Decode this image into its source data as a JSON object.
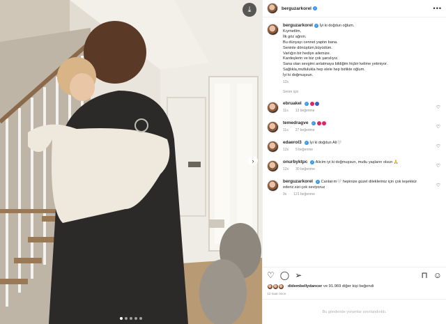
{
  "post": {
    "username": "berguzarkorel",
    "more_label": "•••",
    "caption_lines": [
      "İyi ki doğdun oğlum.",
      "Kıymetlim,",
      "İlk göz ağrım.",
      "Bu dünyayı cennet yaptın bana.",
      "Seninle dönüştüm,büyüdüm.",
      "Varlığın bir hediye ailemize.",
      "Kardeşlerin ve biz çok şanslıyız.",
      "Sana olan sevgimi anlatmaya bildiğim hiçbir kelime yetmiyor.",
      "Sağlıkla,mutlulukla hep elele hep birlikte oğlum.",
      "İyi ki doğmuşsun."
    ],
    "caption_time": "12s",
    "translate_label": "Seren için",
    "likes_users": "didembellydancer",
    "likes_text": "ve 91.969 diğer kişi beğendi",
    "post_time": "12 saat önce",
    "add_comment_placeholder": "Bu gönderide yorumlar sınırlandırıldı."
  },
  "comments": [
    {
      "username": "ebruakel",
      "text": "",
      "time": "11s",
      "likes": "13 beğenme",
      "emoji_colors": [
        "#e0245e",
        "#3a5cc9"
      ]
    },
    {
      "username": "temedragve",
      "text": "",
      "time": "11s",
      "likes": "27 beğenme",
      "emoji_colors": [
        "#e0245e",
        "#e0245e"
      ]
    },
    {
      "username": "edaerol3",
      "text": "İyi ki doğdun Ali🤍",
      "time": "12s",
      "likes": "5 beğenme",
      "emoji_colors": []
    },
    {
      "username": "onurbyktpc",
      "text": "Alicim iyi ki doğmuşsun, mutlu yaşların olsun 🙏",
      "time": "12s",
      "likes": "30 beğenme",
      "emoji_colors": []
    },
    {
      "username": "berguzarkorel",
      "text": "Canlarım🤍 hepinize güzel dilekleriniz için çok teşekkür ederiz.sizi çok seviyoruz",
      "time": "9s",
      "likes": "121 beğenme",
      "emoji_colors": []
    }
  ],
  "icons": {
    "download": "download-icon",
    "next": "chevron-right-icon",
    "heart": "heart-icon",
    "comment": "comment-icon",
    "share": "share-icon",
    "bookmark": "bookmark-icon",
    "emoji": "emoji-icon"
  },
  "carousel": {
    "count": 5,
    "active": 0
  },
  "colors": {
    "verified": "#3897f0",
    "muted": "#8e8e8e",
    "text": "#262626"
  }
}
